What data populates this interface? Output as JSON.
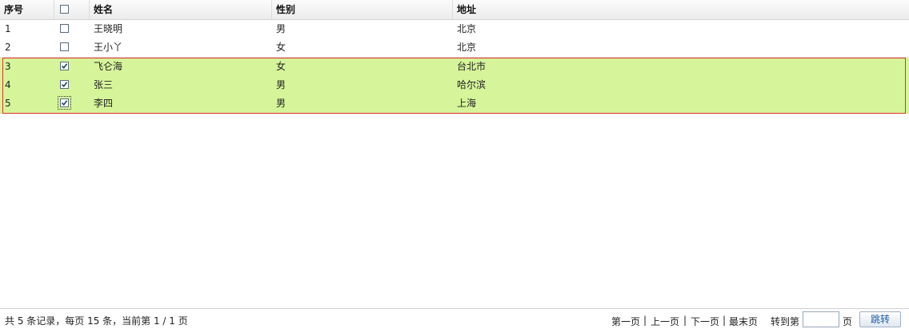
{
  "header": {
    "col_index": "序号",
    "col_name": "姓名",
    "col_gender": "性别",
    "col_address": "地址"
  },
  "rows": [
    {
      "index": "1",
      "name": "王晓明",
      "gender": "男",
      "address": "北京",
      "checked": false
    },
    {
      "index": "2",
      "name": "王小丫",
      "gender": "女",
      "address": "北京",
      "checked": false
    },
    {
      "index": "3",
      "name": "飞仑海",
      "gender": "女",
      "address": "台北市",
      "checked": true
    },
    {
      "index": "4",
      "name": "张三",
      "gender": "男",
      "address": "哈尔滨",
      "checked": true
    },
    {
      "index": "5",
      "name": "李四",
      "gender": "男",
      "address": "上海",
      "checked": true
    }
  ],
  "footer": {
    "info": "共 5 条记录，每页 15 条，当前第 1 / 1 页",
    "first": "第一页",
    "prev": "上一页",
    "next": "下一页",
    "last": "最末页",
    "goto_prefix": "转到第",
    "goto_suffix": "页",
    "page_input_value": "",
    "jump": "跳转",
    "separator": "|"
  },
  "colors": {
    "selected_row": "#d6f59a",
    "selection_border": "#e03030"
  }
}
